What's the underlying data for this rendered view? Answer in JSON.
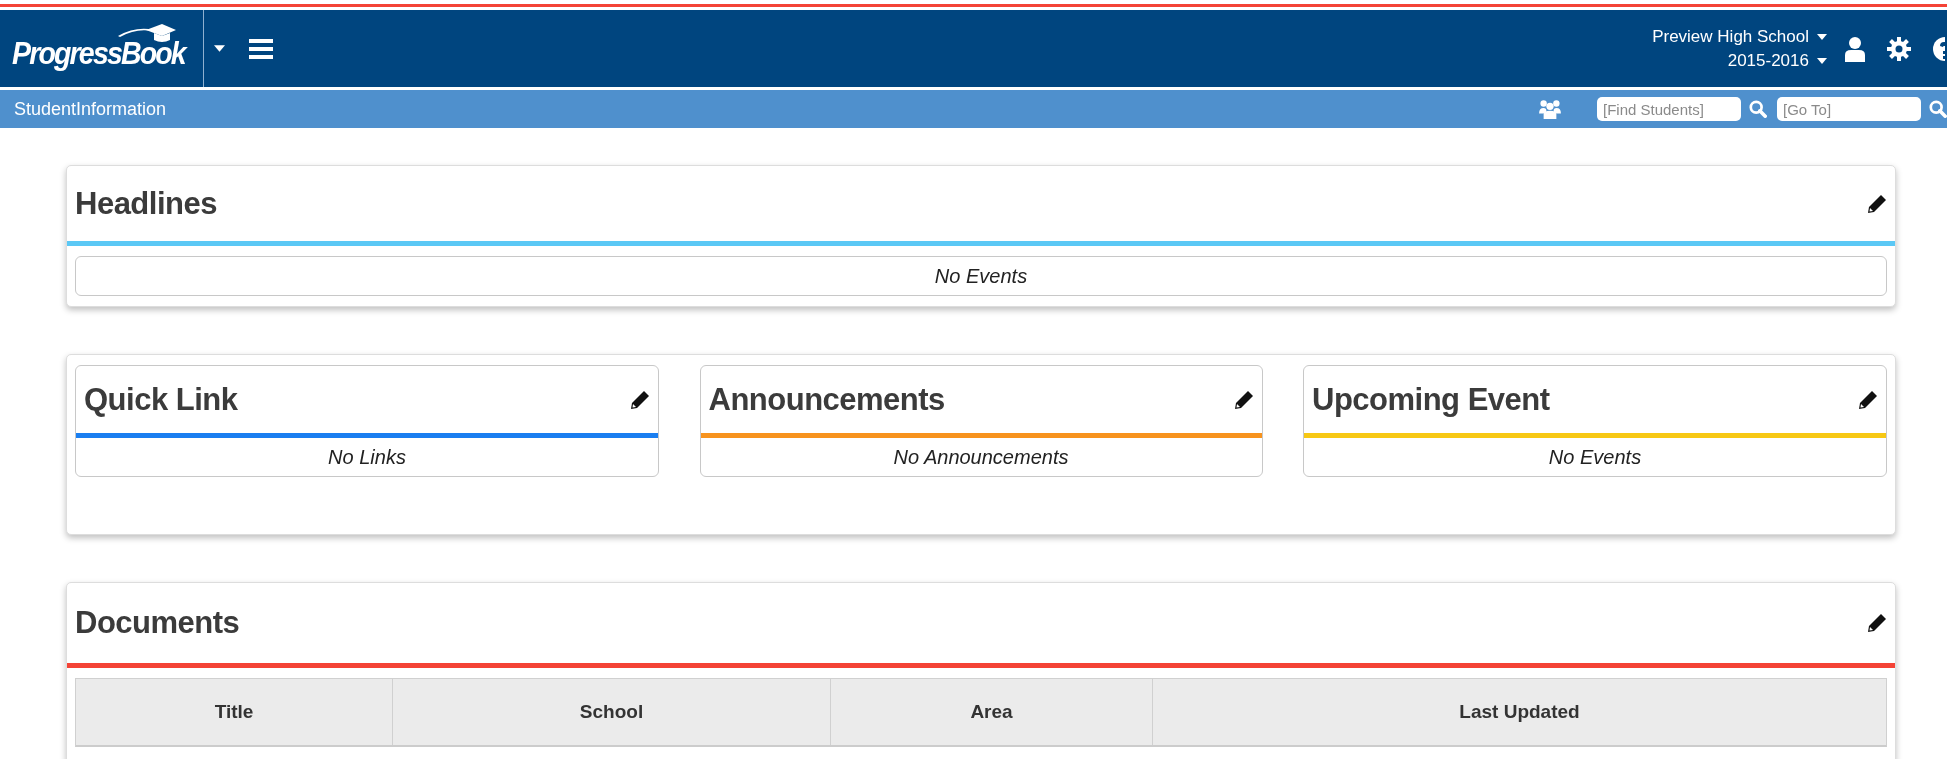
{
  "header": {
    "logo": "ProgressBook",
    "school": "Preview High School",
    "year": "2015-2016"
  },
  "subbar": {
    "title": "StudentInformation",
    "find_students": {
      "placeholder": "[Find Students]"
    },
    "go_to": {
      "placeholder": "[Go To]"
    }
  },
  "headlines": {
    "title": "Headlines",
    "color": "#5bc8f5",
    "message": "No Events"
  },
  "widgets": [
    {
      "title": "Quick Link",
      "color": "#1a7ef0",
      "message": "No Links"
    },
    {
      "title": "Announcements",
      "color": "#f7931e",
      "message": "No Announcements"
    },
    {
      "title": "Upcoming Event",
      "color": "#f7c814",
      "message": "No Events"
    }
  ],
  "documents": {
    "title": "Documents",
    "color": "#f44336",
    "columns": [
      "Title",
      "School",
      "Area",
      "Last Updated"
    ]
  }
}
